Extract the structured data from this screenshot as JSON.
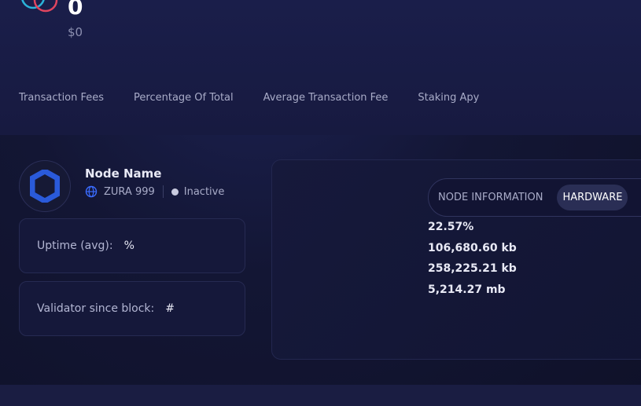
{
  "header": {
    "big_number": "0",
    "usd_value": "$0"
  },
  "stat_tabs": [
    "Transaction Fees",
    "Percentage Of Total",
    "Average Transaction Fee",
    "Staking Apy"
  ],
  "node": {
    "name": "Node Name",
    "network": "ZURA 999",
    "status": "Inactive"
  },
  "cards": {
    "uptime_label": "Uptime (avg):",
    "uptime_value": "%",
    "validator_label": "Validator since block:",
    "validator_value": "#"
  },
  "info_tabs": {
    "node_information": "NODE INFORMATION",
    "hardware": "HARDWARE"
  },
  "hardware_values": [
    "22.57%",
    "106,680.60 kb",
    "258,225.21 kb",
    "5,214.27 mb"
  ],
  "colors": {
    "background": "#131634",
    "accent_blue": "#2a5ada",
    "logo_cyan": "#2bb3d9",
    "logo_red": "#e0455f"
  }
}
